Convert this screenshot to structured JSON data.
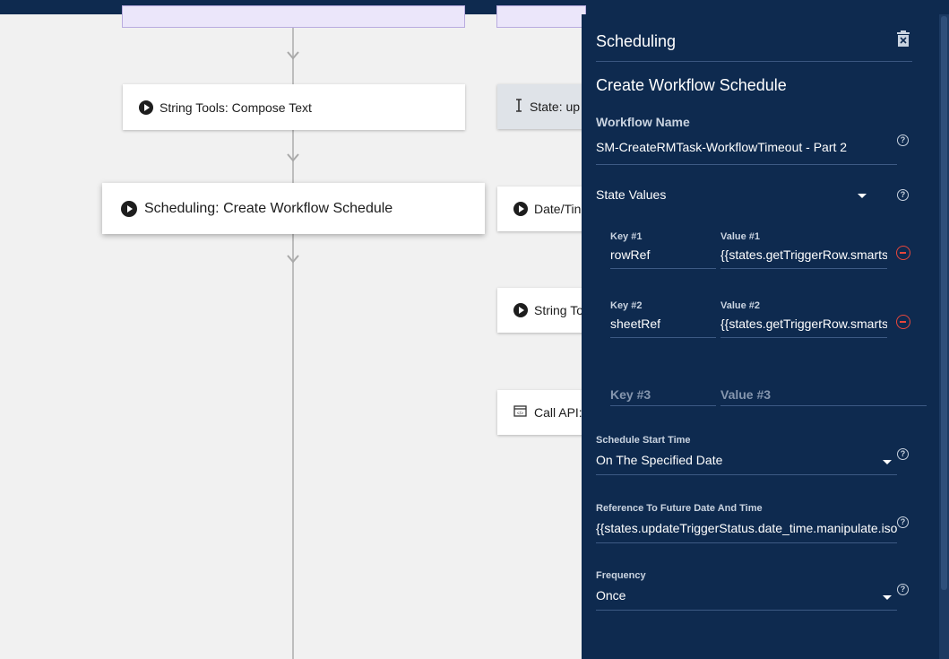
{
  "canvas": {
    "left_cards": {
      "compose_text": "String Tools: Compose Text",
      "create_schedule": "Scheduling: Create Workflow Schedule"
    },
    "right_cards": {
      "state_update": "State: up",
      "date_time": "Date/Tin",
      "string_tools": "String To",
      "call_api": "Call API:"
    }
  },
  "panel": {
    "title": "Scheduling",
    "subtitle": "Create Workflow Schedule",
    "workflow_name": {
      "label": "Workflow Name",
      "value": "SM-CreateRMTask-WorkflowTimeout - Part 2"
    },
    "state_values": {
      "label": "State Values",
      "rows": [
        {
          "key_label": "Key #1",
          "key": "rowRef",
          "value_label": "Value #1",
          "value": "{{states.getTriggerRow.smartsheet"
        },
        {
          "key_label": "Key #2",
          "key": "sheetRef",
          "value_label": "Value #2",
          "value": "{{states.getTriggerRow.smartsheet"
        }
      ],
      "empty_row": {
        "key_label": "Key #3",
        "value_label": "Value #3"
      }
    },
    "schedule_start": {
      "label": "Schedule Start Time",
      "value": "On The Specified Date"
    },
    "future_ref": {
      "label": "Reference To Future Date And Time",
      "value": "{{states.updateTriggerStatus.date_time.manipulate.iso"
    },
    "frequency": {
      "label": "Frequency",
      "value": "Once"
    }
  },
  "colors": {
    "panel_bg": "#0e2a4f",
    "canvas_bg": "#f1f1f1",
    "remove_red": "#e8473c"
  }
}
